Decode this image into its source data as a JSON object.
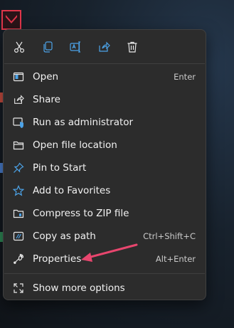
{
  "quick_actions": [
    {
      "icon": "scissors-icon",
      "label": "Cut"
    },
    {
      "icon": "copy-icon",
      "label": "Copy"
    },
    {
      "icon": "rename-icon",
      "label": "Rename"
    },
    {
      "icon": "share-icon",
      "label": "Share"
    },
    {
      "icon": "trash-icon",
      "label": "Delete"
    }
  ],
  "menu": {
    "items": [
      {
        "label": "Open",
        "shortcut": "Enter",
        "icon": "window-icon"
      },
      {
        "label": "Share",
        "shortcut": "",
        "icon": "share-icon"
      },
      {
        "label": "Run as administrator",
        "shortcut": "",
        "icon": "shield-icon"
      },
      {
        "label": "Open file location",
        "shortcut": "",
        "icon": "folder-icon"
      },
      {
        "label": "Pin to Start",
        "shortcut": "",
        "icon": "pin-icon"
      },
      {
        "label": "Add to Favorites",
        "shortcut": "",
        "icon": "star-icon"
      },
      {
        "label": "Compress to ZIP file",
        "shortcut": "",
        "icon": "zip-folder-icon"
      },
      {
        "label": "Copy as path",
        "shortcut": "Ctrl+Shift+C",
        "icon": "copy-path-icon"
      },
      {
        "label": "Properties",
        "shortcut": "Alt+Enter",
        "icon": "wrench-icon"
      }
    ],
    "more_options": {
      "label": "Show more options",
      "icon": "expand-icon"
    }
  },
  "colors": {
    "menu_background": "#2c2c2c",
    "accent": "#4ca3e8",
    "annotation_arrow": "#e8466e",
    "desktop_icon_border": "#e0364a"
  }
}
